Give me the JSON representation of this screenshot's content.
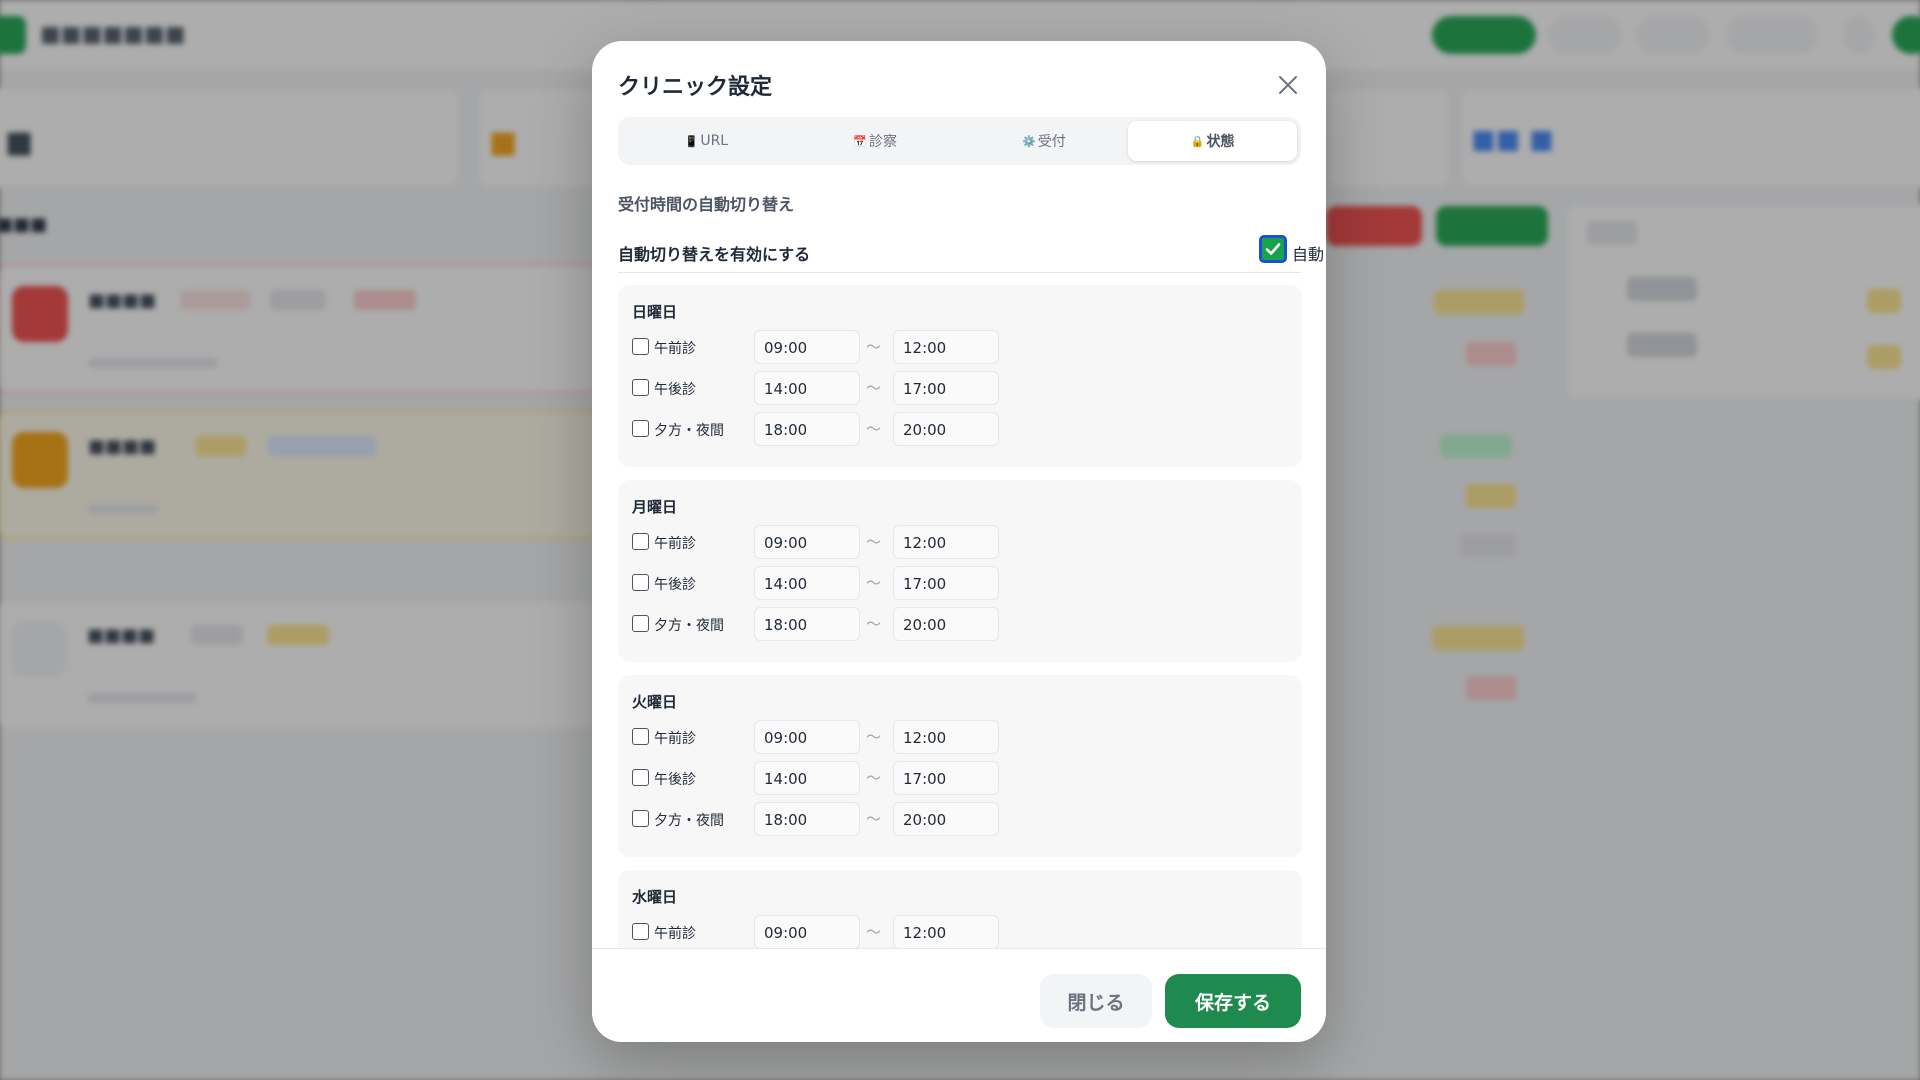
{
  "modal": {
    "title": "クリニック設定",
    "tabs": [
      {
        "icon": "📱",
        "label": "URL",
        "active": false
      },
      {
        "icon": "📅",
        "label": "診察",
        "active": false
      },
      {
        "icon": "⚙️",
        "label": "受付",
        "active": false
      },
      {
        "icon": "🔒",
        "label": "状態",
        "active": true
      }
    ],
    "section_heading": "受付時間の自動切り替え",
    "auto_toggle": {
      "label": "自動切り替えを有効にする",
      "checkbox_label": "自動",
      "checked": true
    },
    "tilde": "〜",
    "days": [
      {
        "name": "日曜日",
        "slots": [
          {
            "label": "午前診",
            "start": "09:00",
            "end": "12:00",
            "checked": false
          },
          {
            "label": "午後診",
            "start": "14:00",
            "end": "17:00",
            "checked": false
          },
          {
            "label": "夕方・夜間",
            "start": "18:00",
            "end": "20:00",
            "checked": false
          }
        ]
      },
      {
        "name": "月曜日",
        "slots": [
          {
            "label": "午前診",
            "start": "09:00",
            "end": "12:00",
            "checked": false
          },
          {
            "label": "午後診",
            "start": "14:00",
            "end": "17:00",
            "checked": false
          },
          {
            "label": "夕方・夜間",
            "start": "18:00",
            "end": "20:00",
            "checked": false
          }
        ]
      },
      {
        "name": "火曜日",
        "slots": [
          {
            "label": "午前診",
            "start": "09:00",
            "end": "12:00",
            "checked": false
          },
          {
            "label": "午後診",
            "start": "14:00",
            "end": "17:00",
            "checked": false
          },
          {
            "label": "夕方・夜間",
            "start": "18:00",
            "end": "20:00",
            "checked": false
          }
        ]
      },
      {
        "name": "水曜日",
        "slots": [
          {
            "label": "午前診",
            "start": "09:00",
            "end": "12:00",
            "checked": false
          }
        ]
      }
    ],
    "footer": {
      "close_label": "閉じる",
      "save_label": "保存する"
    }
  },
  "colors": {
    "accent": "#1f8a4e",
    "checkbox_border": "#1d4ed8"
  }
}
